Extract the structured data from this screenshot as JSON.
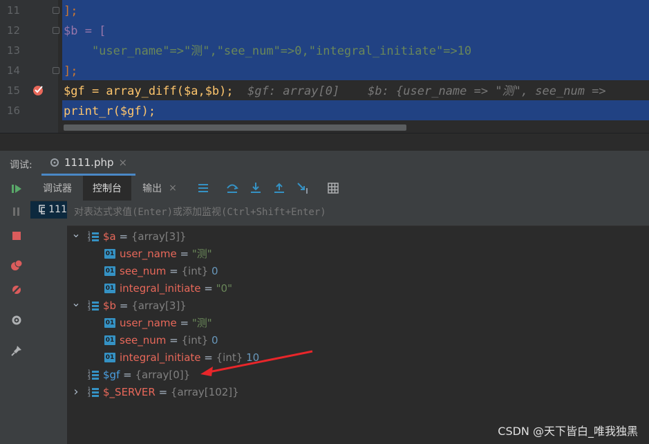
{
  "editor": {
    "line_numbers": [
      "11",
      "12",
      "13",
      "14",
      "15",
      "16"
    ],
    "lines": [
      {
        "code": "];"
      },
      {
        "code": "$b = ["
      },
      {
        "code": "    \"user_name\"=>\"测\",\"see_num\"=>0,\"integral_initiate\"=>10"
      },
      {
        "code": "];"
      },
      {
        "code": "$gf = array_diff($a,$b);",
        "hint": "$gf: array[0]    $b: {user_name => \"测\", see_num =>"
      },
      {
        "code": "print_r($gf);"
      }
    ]
  },
  "debug": {
    "label": "调试:",
    "file_tab": "1111.php",
    "frame_item": "111"
  },
  "tool_tabs": {
    "debugger": "调试器",
    "console": "控制台",
    "output": "输出"
  },
  "eval": {
    "placeholder": "对表达式求值(Enter)或添加监视(Ctrl+Shift+Enter)"
  },
  "variables": [
    {
      "name": "$a",
      "eq": " = ",
      "value": "{array[3]}",
      "kind": "array",
      "expanded": true,
      "level": 0
    },
    {
      "name": "user_name",
      "eq": " = ",
      "value": "\"测\"",
      "kind": "string",
      "level": 1
    },
    {
      "name": "see_num",
      "eq": " = ",
      "type": "{int} ",
      "value": "0",
      "kind": "int",
      "level": 1
    },
    {
      "name": "integral_initiate",
      "eq": " = ",
      "value": "\"0\"",
      "kind": "string",
      "level": 1
    },
    {
      "name": "$b",
      "eq": " = ",
      "value": "{array[3]}",
      "kind": "array",
      "expanded": true,
      "level": 0
    },
    {
      "name": "user_name",
      "eq": " = ",
      "value": "\"测\"",
      "kind": "string",
      "level": 1
    },
    {
      "name": "see_num",
      "eq": " = ",
      "type": "{int} ",
      "value": "0",
      "kind": "int",
      "level": 1
    },
    {
      "name": "integral_initiate",
      "eq": " = ",
      "type": "{int} ",
      "value": "10",
      "kind": "int",
      "level": 1
    },
    {
      "name": "$gf",
      "eq": " = ",
      "value": "{array[0]}",
      "kind": "array",
      "highlight": true,
      "level": 0
    },
    {
      "name": "$_SERVER",
      "eq": " = ",
      "value": "{array[102]}",
      "kind": "array",
      "collapsed": true,
      "level": 0
    }
  ],
  "watermark": "CSDN @天下皆白_唯我独黑",
  "colors": {
    "selection": "#214283",
    "accent": "#3592c4",
    "arrow": "#e8262a"
  }
}
